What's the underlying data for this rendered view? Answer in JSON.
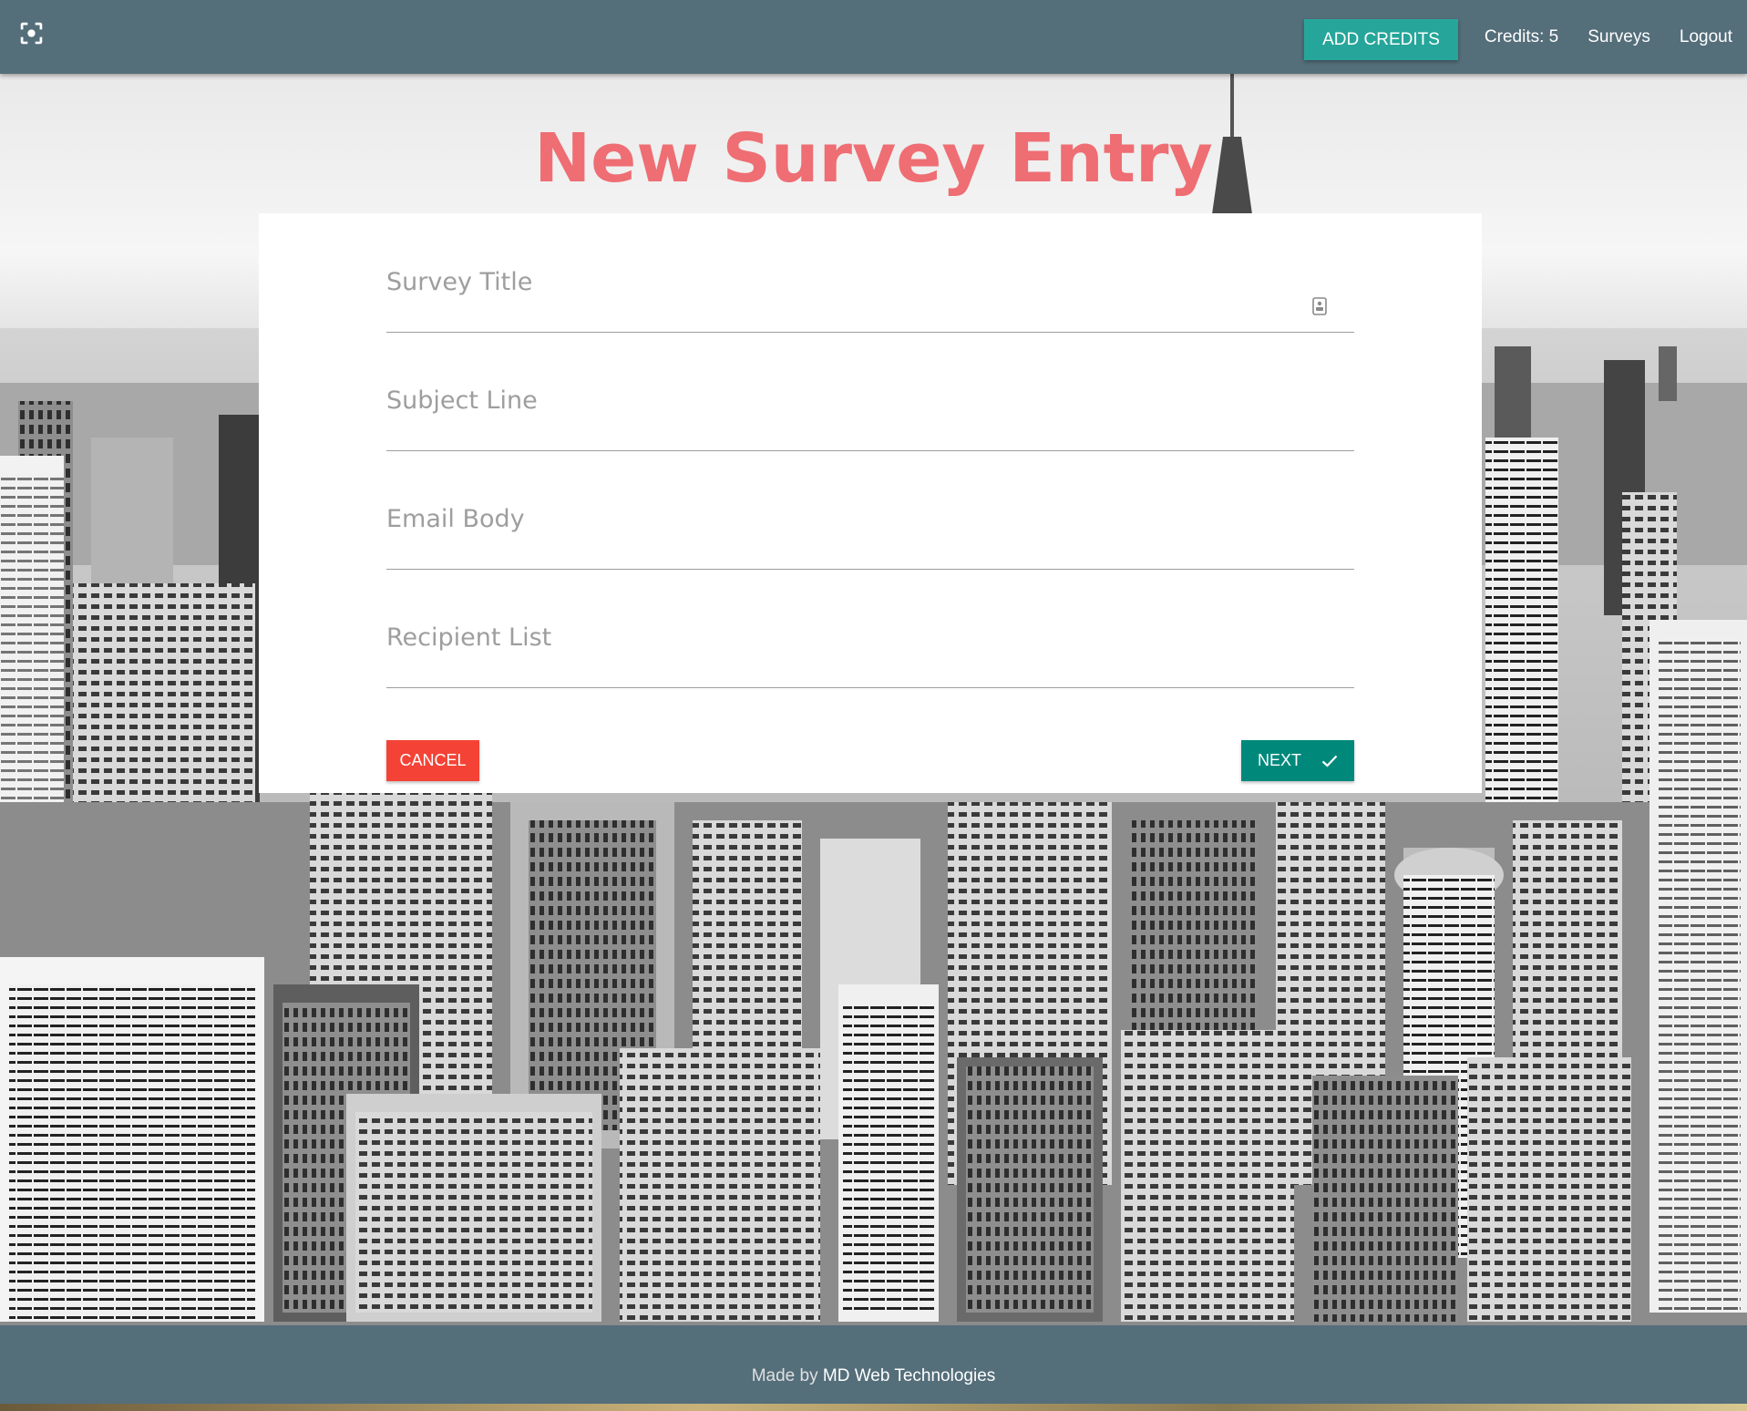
{
  "navbar": {
    "logo_icon": "focus-scan-icon",
    "add_credits_label": "ADD CREDITS",
    "credits_text": "Credits: 5",
    "surveys_label": "Surveys",
    "logout_label": "Logout",
    "color": "#546e7a"
  },
  "page": {
    "title": "New Survey Entry",
    "title_color": "#ee6e73"
  },
  "form": {
    "fields": [
      {
        "label": "Survey Title",
        "value": ""
      },
      {
        "label": "Subject Line",
        "value": ""
      },
      {
        "label": "Email Body",
        "value": ""
      },
      {
        "label": "Recipient List",
        "value": ""
      }
    ],
    "cancel_label": "CANCEL",
    "next_label": "NEXT",
    "next_icon": "check-icon",
    "cancel_color": "#f44336",
    "next_color": "#00897b"
  },
  "footer": {
    "prefix": "Made by",
    "author": "MD Web Technologies"
  }
}
